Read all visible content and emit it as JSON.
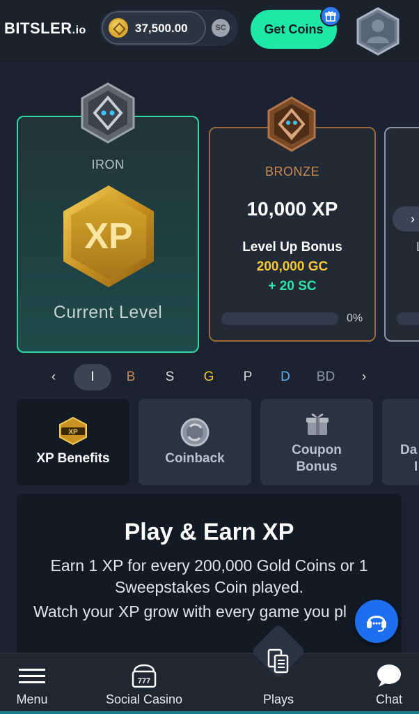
{
  "header": {
    "logo_main": "BITSLER",
    "logo_suffix": ".io",
    "balance": "37,500.00",
    "currency_toggle": "SC",
    "get_coins_label": "Get Coins"
  },
  "levels": {
    "current": {
      "name": "IRON",
      "status_label": "Current Level",
      "badge_text": "XP"
    },
    "next": {
      "name": "BRONZE",
      "xp_required": "10,000 XP",
      "bonus_label": "Level Up Bonus",
      "bonus_gc": "200,000 GC",
      "bonus_sc": "+ 20 SC",
      "progress_text": "0%",
      "progress_value": 0
    },
    "peek": {
      "arrow": "›",
      "letter": "L"
    }
  },
  "level_nav": {
    "prev": "‹",
    "next": "›",
    "items": [
      {
        "label": "I",
        "color": "#ffffff"
      },
      {
        "label": "B",
        "color": "#c98a52"
      },
      {
        "label": "S",
        "color": "#d4dbe2"
      },
      {
        "label": "G",
        "color": "#f5c634"
      },
      {
        "label": "P",
        "color": "#d4dbe2"
      },
      {
        "label": "D",
        "color": "#5ab4f0"
      },
      {
        "label": "BD",
        "color": "#8a96a8"
      }
    ]
  },
  "tabs": [
    {
      "label": "XP Benefits",
      "icon": "xp-badge-icon"
    },
    {
      "label": "Coinback",
      "icon": "coinback-icon"
    },
    {
      "label_line1": "Coupon",
      "label_line2": "Bonus",
      "icon": "gift-icon"
    },
    {
      "label_line1": "Da",
      "label_line2": "I"
    }
  ],
  "info": {
    "title": "Play & Earn XP",
    "text": "Earn 1 XP for every 200,000 Gold Coins or 1 Sweepstakes Coin played.",
    "text_line3": "Watch your XP grow with every game you pl"
  },
  "bottom_nav": {
    "menu": "Menu",
    "social_casino": "Social Casino",
    "plays": "Plays",
    "chat": "Chat"
  },
  "colors": {
    "accent_green": "#1fe7a6",
    "gold": "#f5c634",
    "bronze": "#c98a52",
    "support_blue": "#1e6ff0"
  }
}
